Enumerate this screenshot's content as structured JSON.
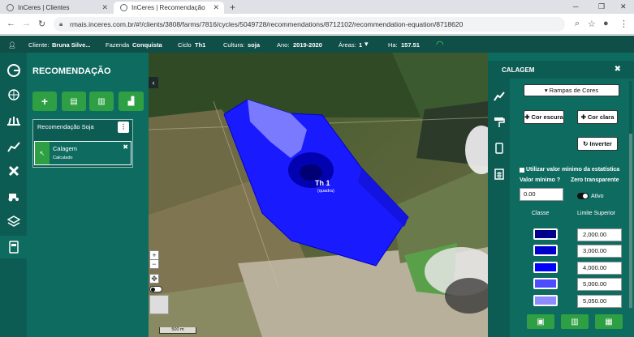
{
  "browser": {
    "tabs": [
      {
        "title": "InCeres | Clientes"
      },
      {
        "title": "InCeres | Recomendação"
      }
    ],
    "url": "rmais.inceres.com.br/#!/clients/3808/farms/7816/cycles/5049728/recommendations/8712102/recommendation-equation/8718620"
  },
  "infobar": {
    "cliente_label": "Cliente:",
    "cliente_value": "Bruna Silve...",
    "fazenda_label": "Fazenda",
    "fazenda_value": "Conquista",
    "ciclo_label": "Ciclo",
    "ciclo_value": "Th1",
    "cultura_label": "Cultura:",
    "cultura_value": "soja",
    "ano_label": "Ano:",
    "ano_value": "2019-2020",
    "areas_label": "Áreas:",
    "areas_value": "1",
    "ha_label": "Ha:",
    "ha_value": "157.51"
  },
  "recommendation_panel": {
    "title": "RECOMENDAÇÃO",
    "group_title": "Recomendação Soja",
    "item_title": "Calagem",
    "item_status": "Calculado"
  },
  "map": {
    "field_label": "Th 1",
    "field_sub": "(quadra)",
    "scale": "500 m",
    "field_color": "#1a1aff"
  },
  "calagem_panel": {
    "title": "CALAGEM",
    "ramps_button": "Rampas de Cores",
    "dark_button": "Cor escura",
    "light_button": "Cor clara",
    "invert_button": "Inverter",
    "use_min_label": "Utilizar valor mínimo da estatística",
    "min_value_label": "Valor mínimo",
    "zero_label": "Zero transparente",
    "min_value": "0.00",
    "active_label": "Ativo",
    "class_header": "Classe",
    "limit_header": "Limite Superior",
    "classes": [
      {
        "color": "#00008b",
        "limit": "2,000.00"
      },
      {
        "color": "#0000cd",
        "limit": "3,000.00"
      },
      {
        "color": "#0000ff",
        "limit": "4,000.00"
      },
      {
        "color": "#4d4dff",
        "limit": "5,000.00"
      },
      {
        "color": "#8c8cff",
        "limit": "5,050.00"
      }
    ]
  }
}
